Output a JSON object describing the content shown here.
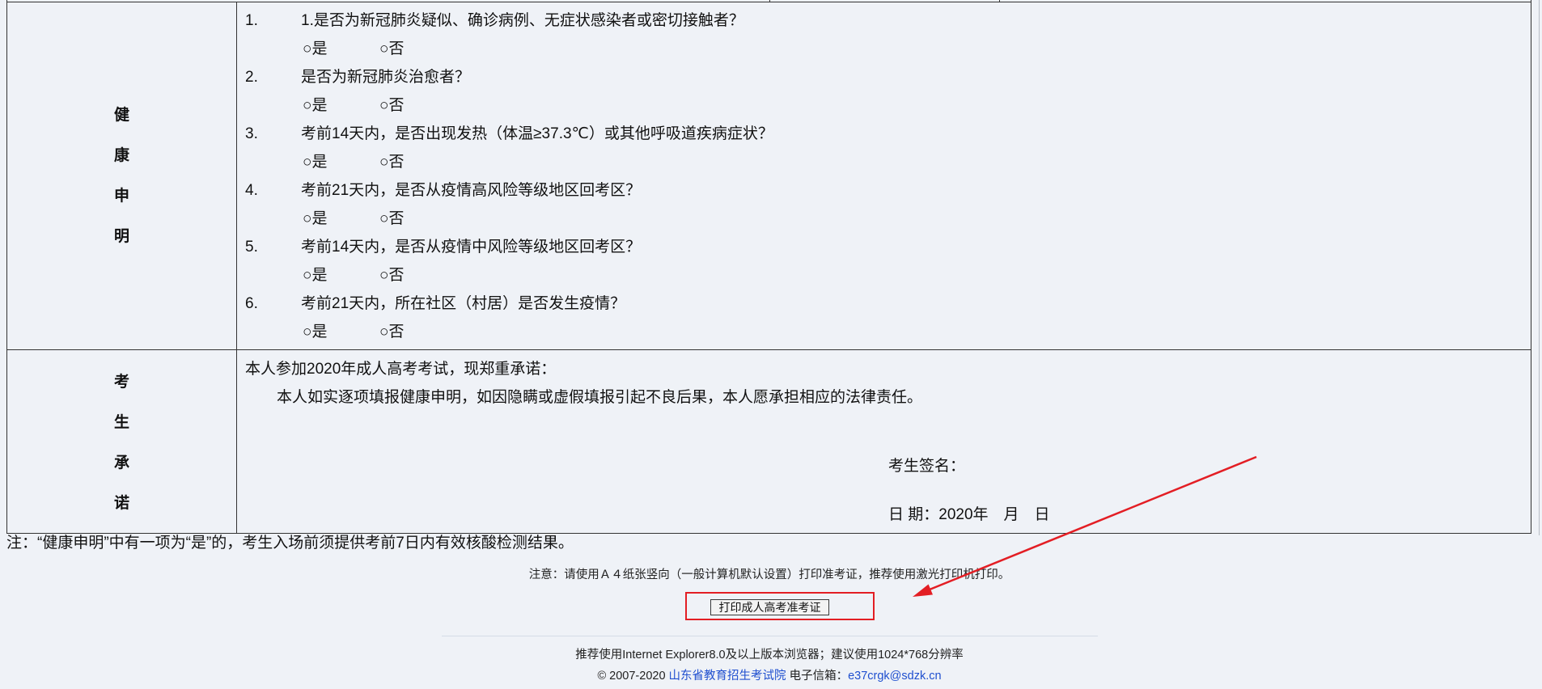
{
  "health_declaration": {
    "label_chars": [
      "健",
      "康",
      "申",
      "明"
    ],
    "questions": [
      {
        "number": "1.",
        "text": "1.是否为新冠肺炎疑似、确诊病例、无症状感染者或密切接触者？",
        "options": [
          "○是",
          "○否"
        ]
      },
      {
        "number": "2.",
        "text": "是否为新冠肺炎治愈者？",
        "options": [
          "○是",
          "○否"
        ]
      },
      {
        "number": "3.",
        "text": "考前14天内，是否出现发热（体温≥37.3℃）或其他呼吸道疾病症状？",
        "options": [
          "○是",
          "○否"
        ]
      },
      {
        "number": "4.",
        "text": "考前21天内，是否从疫情高风险等级地区回考区？",
        "options": [
          "○是",
          "○否"
        ]
      },
      {
        "number": "5.",
        "text": "考前14天内，是否从疫情中风险等级地区回考区？",
        "options": [
          "○是",
          "○否"
        ]
      },
      {
        "number": "6.",
        "text": "考前21天内，所在社区（村居）是否发生疫情？",
        "options": [
          "○是",
          "○否"
        ]
      }
    ]
  },
  "candidate_commitment": {
    "label_chars": [
      "考",
      "生",
      "承",
      "诺"
    ],
    "intro": "本人参加2020年成人高考考试，现郑重承诺：",
    "statement": "本人如实逐项填报健康申明，如因隐瞒或虚假填报引起不良后果，本人愿承担相应的法律责任。",
    "signature_label": "考生签名：",
    "date_line": "日 期：2020年　月　日"
  },
  "table_note": "注：“健康申明”中有一项为“是”的，考生入场前须提供考前7日内有效核酸检测结果。",
  "print_notice": "注意：请使用Ａ４纸张竖向（一般计算机默认设置）打印准考证，推荐使用激光打印机打印。",
  "print_button_label": "打印成人高考准考证",
  "footer": {
    "browser_tip": "推荐使用Internet Explorer8.0及以上版本浏览器；建议使用1024*768分辨率",
    "copyright": "© 2007-2020",
    "org_link": "山东省教育招生考试院",
    "email_label": "电子信箱：",
    "email_link": "e37crgk@sdzk.cn"
  },
  "colors": {
    "background": "#eff2f7",
    "table_border": "#333333",
    "text": "#111111",
    "link": "#1f4fcf",
    "annotation_red": "#e31e24",
    "separator": "#d5dce6"
  }
}
